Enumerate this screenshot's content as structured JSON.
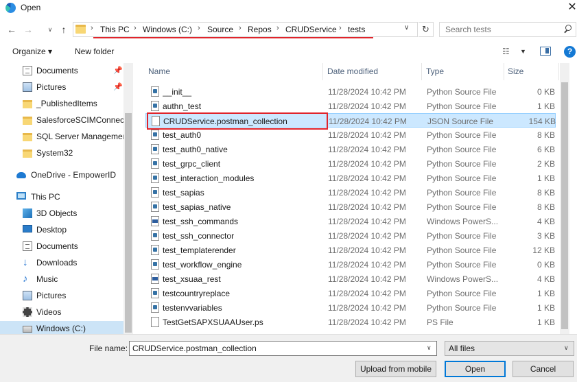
{
  "window": {
    "title": "Open",
    "close_glyph": "✕"
  },
  "nav": {
    "back_glyph": "←",
    "forward_glyph": "→",
    "recent_glyph": "∨",
    "up_glyph": "↑",
    "refresh_glyph": "↻"
  },
  "address": {
    "crumbs": [
      "This PC",
      "Windows (C:)",
      "Source",
      "Repos",
      "CRUDService",
      "tests"
    ],
    "separator": "›",
    "dropdown_glyph": "∨"
  },
  "search": {
    "placeholder": "Search tests"
  },
  "toolbar": {
    "organize_label": "Organize ▾",
    "new_folder_label": "New folder",
    "view_glyph": "☷",
    "view_dropdown_glyph": "▼",
    "help_glyph": "?"
  },
  "sidebar": {
    "pin_glyph": "📌",
    "items": [
      {
        "label": "Documents",
        "icon": "documents-icon",
        "pinned": true
      },
      {
        "label": "Pictures",
        "icon": "pictures-icon",
        "pinned": true
      },
      {
        "label": "_PublishedItems",
        "icon": "folder-icon",
        "pinned": false
      },
      {
        "label": "SalesforceSCIMConnect",
        "icon": "folder-icon",
        "pinned": false
      },
      {
        "label": "SQL Server Managemen",
        "icon": "folder-icon",
        "pinned": false
      },
      {
        "label": "System32",
        "icon": "folder-icon",
        "pinned": false
      },
      {
        "label": "OneDrive - EmpowerID",
        "icon": "onedrive-icon",
        "pinned": false
      },
      {
        "label": "This PC",
        "icon": "this-pc-icon",
        "pinned": false
      },
      {
        "label": "3D Objects",
        "icon": "3d-objects-icon",
        "pinned": false
      },
      {
        "label": "Desktop",
        "icon": "desktop-icon",
        "pinned": false
      },
      {
        "label": "Documents",
        "icon": "documents-icon",
        "pinned": false
      },
      {
        "label": "Downloads",
        "icon": "downloads-icon",
        "pinned": false
      },
      {
        "label": "Music",
        "icon": "music-icon",
        "pinned": false
      },
      {
        "label": "Pictures",
        "icon": "pictures-icon",
        "pinned": false
      },
      {
        "label": "Videos",
        "icon": "videos-icon",
        "pinned": false
      },
      {
        "label": "Windows (C:)",
        "icon": "drive-icon",
        "pinned": false,
        "selected": true
      }
    ]
  },
  "columns": {
    "name": "Name",
    "date": "Date modified",
    "type": "Type",
    "size": "Size",
    "sort_glyph": "^"
  },
  "files": [
    {
      "name": "__init__",
      "date": "11/28/2024 10:42 PM",
      "type": "Python Source File",
      "size": "0 KB",
      "kind": "py"
    },
    {
      "name": "authn_test",
      "date": "11/28/2024 10:42 PM",
      "type": "Python Source File",
      "size": "1 KB",
      "kind": "py"
    },
    {
      "name": "CRUDService.postman_collection",
      "date": "11/28/2024 10:42 PM",
      "type": "JSON Source File",
      "size": "154 KB",
      "kind": "json",
      "selected": true
    },
    {
      "name": "test_auth0",
      "date": "11/28/2024 10:42 PM",
      "type": "Python Source File",
      "size": "8 KB",
      "kind": "py"
    },
    {
      "name": "test_auth0_native",
      "date": "11/28/2024 10:42 PM",
      "type": "Python Source File",
      "size": "6 KB",
      "kind": "py"
    },
    {
      "name": "test_grpc_client",
      "date": "11/28/2024 10:42 PM",
      "type": "Python Source File",
      "size": "2 KB",
      "kind": "py"
    },
    {
      "name": "test_interaction_modules",
      "date": "11/28/2024 10:42 PM",
      "type": "Python Source File",
      "size": "1 KB",
      "kind": "py"
    },
    {
      "name": "test_sapias",
      "date": "11/28/2024 10:42 PM",
      "type": "Python Source File",
      "size": "8 KB",
      "kind": "py"
    },
    {
      "name": "test_sapias_native",
      "date": "11/28/2024 10:42 PM",
      "type": "Python Source File",
      "size": "8 KB",
      "kind": "py"
    },
    {
      "name": "test_ssh_commands",
      "date": "11/28/2024 10:42 PM",
      "type": "Windows PowerS...",
      "size": "4 KB",
      "kind": "ps"
    },
    {
      "name": "test_ssh_connector",
      "date": "11/28/2024 10:42 PM",
      "type": "Python Source File",
      "size": "3 KB",
      "kind": "py"
    },
    {
      "name": "test_templaterender",
      "date": "11/28/2024 10:42 PM",
      "type": "Python Source File",
      "size": "12 KB",
      "kind": "py"
    },
    {
      "name": "test_workflow_engine",
      "date": "11/28/2024 10:42 PM",
      "type": "Python Source File",
      "size": "0 KB",
      "kind": "py"
    },
    {
      "name": "test_xsuaa_rest",
      "date": "11/28/2024 10:42 PM",
      "type": "Windows PowerS...",
      "size": "4 KB",
      "kind": "ps"
    },
    {
      "name": "testcountryreplace",
      "date": "11/28/2024 10:42 PM",
      "type": "Python Source File",
      "size": "1 KB",
      "kind": "py"
    },
    {
      "name": "testenvvariables",
      "date": "11/28/2024 10:42 PM",
      "type": "Python Source File",
      "size": "1 KB",
      "kind": "py"
    },
    {
      "name": "TestGetSAPXSUAAUser.ps",
      "date": "11/28/2024 10:42 PM",
      "type": "PS File",
      "size": "1 KB",
      "kind": "ps-file"
    }
  ],
  "footer": {
    "filename_label": "File name:",
    "filename_value": "CRUDService.postman_collection",
    "filetype_value": "All files",
    "dropdown_glyph": "∨",
    "upload_label": "Upload from mobile",
    "open_label": "Open",
    "cancel_label": "Cancel"
  }
}
